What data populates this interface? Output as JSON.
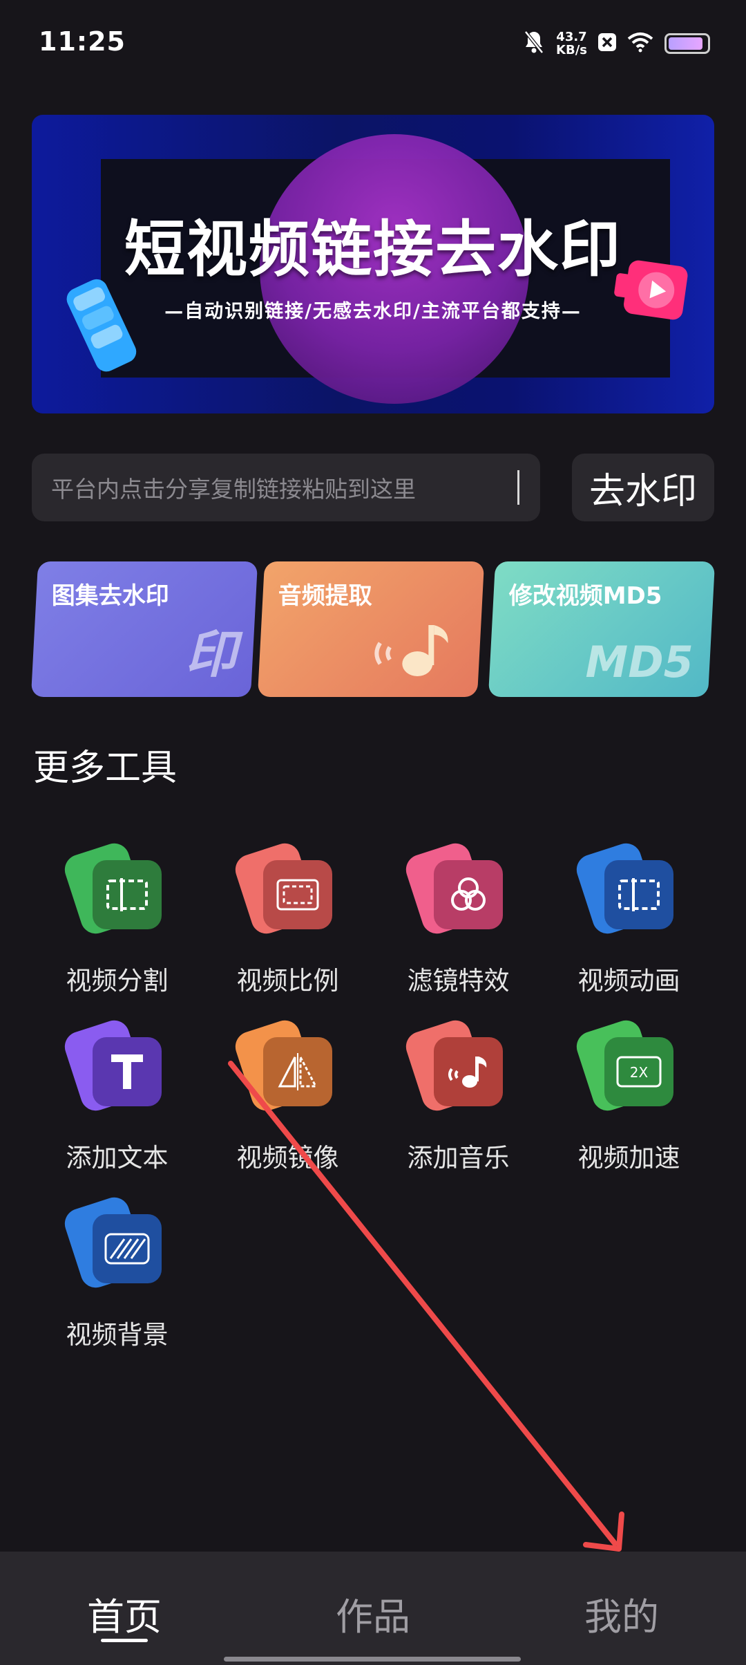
{
  "status_bar": {
    "time": "11:25",
    "net_speed_value": "43.7",
    "net_speed_unit": "KB/s",
    "icons": [
      "mute-bell-icon",
      "x-app-icon",
      "wifi-icon",
      "battery-icon"
    ],
    "battery_level_percent": 90
  },
  "banner": {
    "title": "短视频链接去水印",
    "subtitle": "—自动识别链接/无感去水印/主流平台都支持—",
    "colors": {
      "frame": "#0d1a9c",
      "circle": "#a532c8",
      "play_tag": "#ff2f7a"
    }
  },
  "search": {
    "placeholder": "平台内点击分享复制链接粘贴到这里",
    "button_label": "去水印"
  },
  "feature_cards": [
    {
      "label": "图集去水印",
      "deco": "印",
      "icon": "stamp-icon",
      "color": "#7f7fe6"
    },
    {
      "label": "音频提取",
      "deco": "",
      "icon": "music-note-icon",
      "color": "#f2a46a"
    },
    {
      "label": "修改视频MD5",
      "deco": "MD5",
      "icon": "md5-icon",
      "color": "#7fdcc5"
    }
  ],
  "more_tools": {
    "title": "更多工具",
    "items": [
      {
        "label": "视频分割",
        "icon": "split-icon",
        "color_back": "#3fb75a",
        "color_front": "#2e7c3c"
      },
      {
        "label": "视频比例",
        "icon": "ratio-icon",
        "color_back": "#ef6f6a",
        "color_front": "#b84a48"
      },
      {
        "label": "滤镜特效",
        "icon": "filter-icon",
        "color_back": "#f05f8c",
        "color_front": "#b83d66"
      },
      {
        "label": "视频动画",
        "icon": "animation-icon",
        "color_back": "#2f7de0",
        "color_front": "#1f4fa0"
      },
      {
        "label": "添加文本",
        "icon": "text-icon",
        "color_back": "#8a5cf0",
        "color_front": "#5a37b0"
      },
      {
        "label": "视频镜像",
        "icon": "mirror-icon",
        "color_back": "#f3924a",
        "color_front": "#b86530"
      },
      {
        "label": "添加音乐",
        "icon": "music-icon",
        "color_back": "#ef6f6a",
        "color_front": "#b0403a"
      },
      {
        "label": "视频加速",
        "icon": "speed-icon",
        "color_back": "#48c05a",
        "color_front": "#2e8a3e"
      },
      {
        "label": "视频背景",
        "icon": "background-icon",
        "color_back": "#2f7de0",
        "color_front": "#1f4fa0"
      }
    ]
  },
  "bottom_nav": {
    "items": [
      {
        "label": "首页",
        "active": true
      },
      {
        "label": "作品",
        "active": false
      },
      {
        "label": "我的",
        "active": false
      }
    ]
  },
  "annotation": {
    "arrow_color": "#ef4a4a"
  }
}
